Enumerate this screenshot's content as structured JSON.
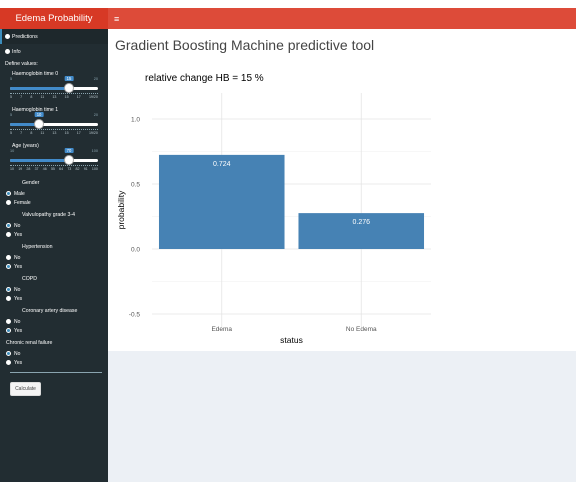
{
  "header": {
    "brand": "Edema Probability",
    "menu_glyph": "≡"
  },
  "sidebar": {
    "menu": [
      {
        "label": "Predictions"
      },
      {
        "label": "Info"
      }
    ],
    "define_label": "Define values:",
    "sliders": [
      {
        "label": "Haemoglobin time 0",
        "min": "5",
        "max": "20",
        "value": "15",
        "fraction": 0.67,
        "ticks": [
          "5",
          "7",
          "8",
          "11",
          "13",
          "15",
          "17",
          "19/20"
        ]
      },
      {
        "label": "Haemoglobin time 1",
        "min": "5",
        "max": "20",
        "value": "10",
        "fraction": 0.33,
        "ticks": [
          "5",
          "7",
          "8",
          "11",
          "13",
          "15",
          "17",
          "19/20"
        ]
      },
      {
        "label": "Age (years)",
        "min": "10",
        "max": "100",
        "value": "70",
        "fraction": 0.67,
        "ticks": [
          "10",
          "19",
          "28",
          "37",
          "46",
          "55",
          "64",
          "73",
          "82",
          "91",
          "100"
        ]
      }
    ],
    "groups": [
      {
        "label": "Gender",
        "options": [
          {
            "label": "Male",
            "selected": true
          },
          {
            "label": "Female",
            "selected": false
          }
        ]
      },
      {
        "label": "Valvulopathy grade 3-4",
        "options": [
          {
            "label": "No",
            "selected": true
          },
          {
            "label": "Yes",
            "selected": false
          }
        ]
      },
      {
        "label": "Hypertension",
        "options": [
          {
            "label": "No",
            "selected": false
          },
          {
            "label": "Yes",
            "selected": true
          }
        ]
      },
      {
        "label": "COPD",
        "options": [
          {
            "label": "No",
            "selected": true
          },
          {
            "label": "Yes",
            "selected": false
          }
        ]
      },
      {
        "label": "Coronary artery disease",
        "options": [
          {
            "label": "No",
            "selected": false
          },
          {
            "label": "Yes",
            "selected": true
          }
        ]
      },
      {
        "label": "Chronic renal failure",
        "options": [
          {
            "label": "No",
            "selected": true
          },
          {
            "label": "Yes",
            "selected": false
          }
        ]
      }
    ],
    "calculate_label": "Calculate"
  },
  "main": {
    "title": "Gradient Boosting Machine predictive tool"
  },
  "colors": {
    "brand": "#d73925",
    "navbar": "#dd4b39",
    "sidebar": "#222d32",
    "bar": "#4682b4"
  },
  "chart_data": {
    "type": "bar",
    "title": "relative change HB = 15 %",
    "xlabel": "status",
    "ylabel": "probability",
    "categories": [
      "Edema",
      "No Edema"
    ],
    "values": [
      0.724,
      0.276
    ],
    "value_labels": [
      "0.724",
      "0.276"
    ],
    "ylim": [
      -0.6,
      1.2
    ],
    "yticks": [
      1.0,
      0.5,
      0.0,
      -0.5
    ],
    "ytick_labels": [
      "1.0",
      "0.5",
      "0.0",
      "-0.5"
    ],
    "grid": true
  }
}
